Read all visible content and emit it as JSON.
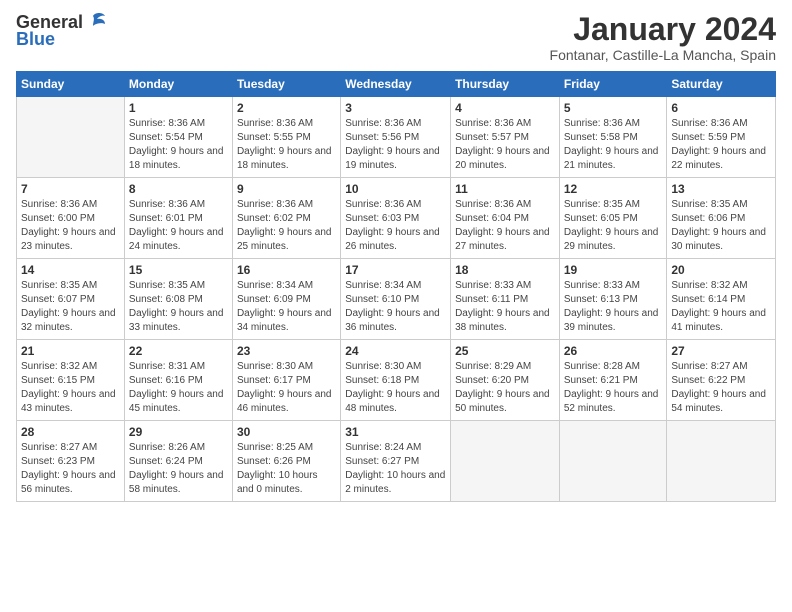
{
  "header": {
    "logo_general": "General",
    "logo_blue": "Blue",
    "month_title": "January 2024",
    "location": "Fontanar, Castille-La Mancha, Spain"
  },
  "days_of_week": [
    "Sunday",
    "Monday",
    "Tuesday",
    "Wednesday",
    "Thursday",
    "Friday",
    "Saturday"
  ],
  "weeks": [
    [
      {
        "num": "",
        "sunrise": "",
        "sunset": "",
        "daylight": "",
        "empty": true
      },
      {
        "num": "1",
        "sunrise": "Sunrise: 8:36 AM",
        "sunset": "Sunset: 5:54 PM",
        "daylight": "Daylight: 9 hours and 18 minutes."
      },
      {
        "num": "2",
        "sunrise": "Sunrise: 8:36 AM",
        "sunset": "Sunset: 5:55 PM",
        "daylight": "Daylight: 9 hours and 18 minutes."
      },
      {
        "num": "3",
        "sunrise": "Sunrise: 8:36 AM",
        "sunset": "Sunset: 5:56 PM",
        "daylight": "Daylight: 9 hours and 19 minutes."
      },
      {
        "num": "4",
        "sunrise": "Sunrise: 8:36 AM",
        "sunset": "Sunset: 5:57 PM",
        "daylight": "Daylight: 9 hours and 20 minutes."
      },
      {
        "num": "5",
        "sunrise": "Sunrise: 8:36 AM",
        "sunset": "Sunset: 5:58 PM",
        "daylight": "Daylight: 9 hours and 21 minutes."
      },
      {
        "num": "6",
        "sunrise": "Sunrise: 8:36 AM",
        "sunset": "Sunset: 5:59 PM",
        "daylight": "Daylight: 9 hours and 22 minutes."
      }
    ],
    [
      {
        "num": "7",
        "sunrise": "Sunrise: 8:36 AM",
        "sunset": "Sunset: 6:00 PM",
        "daylight": "Daylight: 9 hours and 23 minutes."
      },
      {
        "num": "8",
        "sunrise": "Sunrise: 8:36 AM",
        "sunset": "Sunset: 6:01 PM",
        "daylight": "Daylight: 9 hours and 24 minutes."
      },
      {
        "num": "9",
        "sunrise": "Sunrise: 8:36 AM",
        "sunset": "Sunset: 6:02 PM",
        "daylight": "Daylight: 9 hours and 25 minutes."
      },
      {
        "num": "10",
        "sunrise": "Sunrise: 8:36 AM",
        "sunset": "Sunset: 6:03 PM",
        "daylight": "Daylight: 9 hours and 26 minutes."
      },
      {
        "num": "11",
        "sunrise": "Sunrise: 8:36 AM",
        "sunset": "Sunset: 6:04 PM",
        "daylight": "Daylight: 9 hours and 27 minutes."
      },
      {
        "num": "12",
        "sunrise": "Sunrise: 8:35 AM",
        "sunset": "Sunset: 6:05 PM",
        "daylight": "Daylight: 9 hours and 29 minutes."
      },
      {
        "num": "13",
        "sunrise": "Sunrise: 8:35 AM",
        "sunset": "Sunset: 6:06 PM",
        "daylight": "Daylight: 9 hours and 30 minutes."
      }
    ],
    [
      {
        "num": "14",
        "sunrise": "Sunrise: 8:35 AM",
        "sunset": "Sunset: 6:07 PM",
        "daylight": "Daylight: 9 hours and 32 minutes."
      },
      {
        "num": "15",
        "sunrise": "Sunrise: 8:35 AM",
        "sunset": "Sunset: 6:08 PM",
        "daylight": "Daylight: 9 hours and 33 minutes."
      },
      {
        "num": "16",
        "sunrise": "Sunrise: 8:34 AM",
        "sunset": "Sunset: 6:09 PM",
        "daylight": "Daylight: 9 hours and 34 minutes."
      },
      {
        "num": "17",
        "sunrise": "Sunrise: 8:34 AM",
        "sunset": "Sunset: 6:10 PM",
        "daylight": "Daylight: 9 hours and 36 minutes."
      },
      {
        "num": "18",
        "sunrise": "Sunrise: 8:33 AM",
        "sunset": "Sunset: 6:11 PM",
        "daylight": "Daylight: 9 hours and 38 minutes."
      },
      {
        "num": "19",
        "sunrise": "Sunrise: 8:33 AM",
        "sunset": "Sunset: 6:13 PM",
        "daylight": "Daylight: 9 hours and 39 minutes."
      },
      {
        "num": "20",
        "sunrise": "Sunrise: 8:32 AM",
        "sunset": "Sunset: 6:14 PM",
        "daylight": "Daylight: 9 hours and 41 minutes."
      }
    ],
    [
      {
        "num": "21",
        "sunrise": "Sunrise: 8:32 AM",
        "sunset": "Sunset: 6:15 PM",
        "daylight": "Daylight: 9 hours and 43 minutes."
      },
      {
        "num": "22",
        "sunrise": "Sunrise: 8:31 AM",
        "sunset": "Sunset: 6:16 PM",
        "daylight": "Daylight: 9 hours and 45 minutes."
      },
      {
        "num": "23",
        "sunrise": "Sunrise: 8:30 AM",
        "sunset": "Sunset: 6:17 PM",
        "daylight": "Daylight: 9 hours and 46 minutes."
      },
      {
        "num": "24",
        "sunrise": "Sunrise: 8:30 AM",
        "sunset": "Sunset: 6:18 PM",
        "daylight": "Daylight: 9 hours and 48 minutes."
      },
      {
        "num": "25",
        "sunrise": "Sunrise: 8:29 AM",
        "sunset": "Sunset: 6:20 PM",
        "daylight": "Daylight: 9 hours and 50 minutes."
      },
      {
        "num": "26",
        "sunrise": "Sunrise: 8:28 AM",
        "sunset": "Sunset: 6:21 PM",
        "daylight": "Daylight: 9 hours and 52 minutes."
      },
      {
        "num": "27",
        "sunrise": "Sunrise: 8:27 AM",
        "sunset": "Sunset: 6:22 PM",
        "daylight": "Daylight: 9 hours and 54 minutes."
      }
    ],
    [
      {
        "num": "28",
        "sunrise": "Sunrise: 8:27 AM",
        "sunset": "Sunset: 6:23 PM",
        "daylight": "Daylight: 9 hours and 56 minutes."
      },
      {
        "num": "29",
        "sunrise": "Sunrise: 8:26 AM",
        "sunset": "Sunset: 6:24 PM",
        "daylight": "Daylight: 9 hours and 58 minutes."
      },
      {
        "num": "30",
        "sunrise": "Sunrise: 8:25 AM",
        "sunset": "Sunset: 6:26 PM",
        "daylight": "Daylight: 10 hours and 0 minutes."
      },
      {
        "num": "31",
        "sunrise": "Sunrise: 8:24 AM",
        "sunset": "Sunset: 6:27 PM",
        "daylight": "Daylight: 10 hours and 2 minutes."
      },
      {
        "num": "",
        "sunrise": "",
        "sunset": "",
        "daylight": "",
        "empty": true
      },
      {
        "num": "",
        "sunrise": "",
        "sunset": "",
        "daylight": "",
        "empty": true
      },
      {
        "num": "",
        "sunrise": "",
        "sunset": "",
        "daylight": "",
        "empty": true
      }
    ]
  ]
}
